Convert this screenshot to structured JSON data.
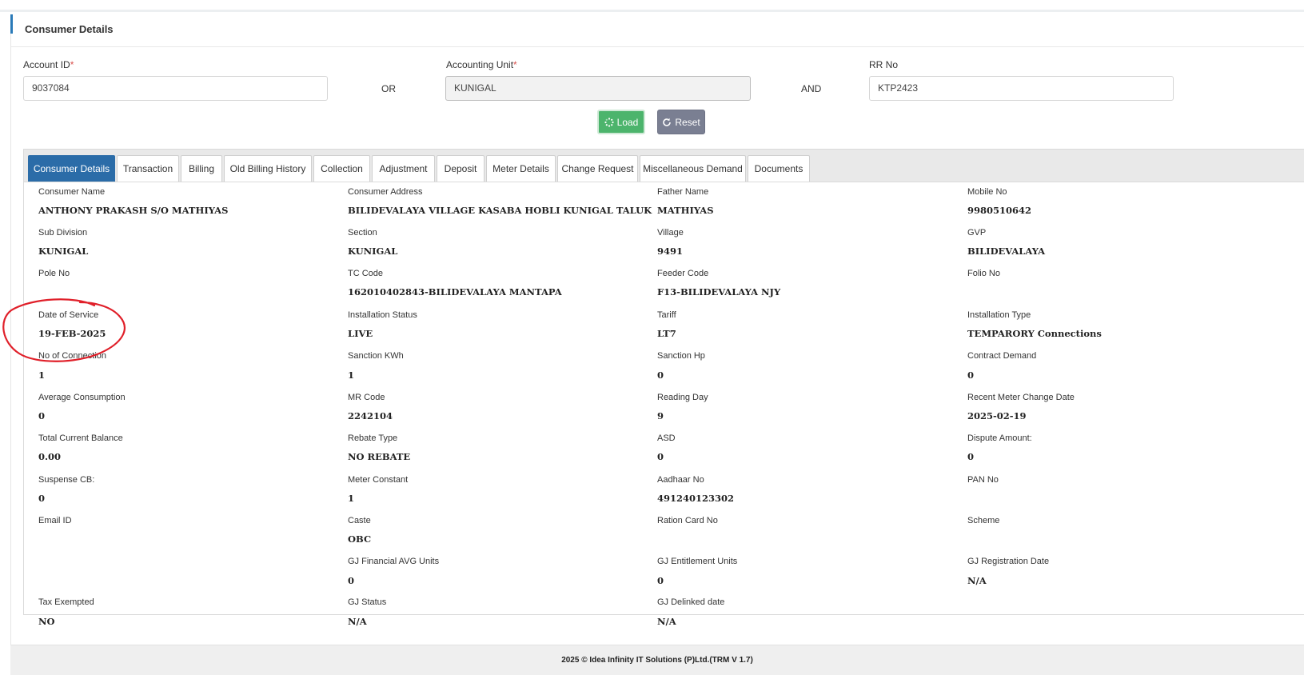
{
  "panel": {
    "title": "Consumer Details"
  },
  "search": {
    "account_id_label": "Account ID",
    "account_id_value": "9037084",
    "or_label": "OR",
    "accounting_unit_label": "Accounting Unit",
    "accounting_unit_value": "KUNIGAL",
    "and_label": "AND",
    "rr_no_label": "RR No",
    "rr_no_value": "KTP2423",
    "required_marker": "*",
    "load_label": "Load",
    "reset_label": "Reset",
    "load_color": "#4cb46c",
    "reset_color": "#7a7f92"
  },
  "tabs": [
    {
      "label": "Consumer Details",
      "active": true
    },
    {
      "label": "Transaction"
    },
    {
      "label": "Billing"
    },
    {
      "label": "Old Billing History"
    },
    {
      "label": "Collection"
    },
    {
      "label": "Adjustment"
    },
    {
      "label": "Deposit"
    },
    {
      "label": "Meter Details"
    },
    {
      "label": "Change Request"
    },
    {
      "label": "Miscellaneous Demand"
    },
    {
      "label": "Documents"
    }
  ],
  "details": {
    "consumer_name": {
      "label": "Consumer Name",
      "value": "ANTHONY PRAKASH S/O MATHIYAS"
    },
    "consumer_address": {
      "label": "Consumer Address",
      "value": "BILIDEVALAYA VILLAGE KASABA HOBLI KUNIGAL TALUK"
    },
    "father_name": {
      "label": "Father Name",
      "value": "MATHIYAS"
    },
    "mobile_no": {
      "label": "Mobile No",
      "value": "9980510642"
    },
    "sub_division": {
      "label": "Sub Division",
      "value": "KUNIGAL"
    },
    "section": {
      "label": "Section",
      "value": "KUNIGAL"
    },
    "village": {
      "label": "Village",
      "value": "9491"
    },
    "gvp": {
      "label": "GVP",
      "value": "BILIDEVALAYA"
    },
    "pole_no": {
      "label": "Pole No",
      "value": ""
    },
    "tc_code": {
      "label": "TC Code",
      "value": "162010402843-BILIDEVALAYA MANTAPA"
    },
    "feeder_code": {
      "label": "Feeder Code",
      "value": "F13-BILIDEVALAYA NJY"
    },
    "folio_no": {
      "label": "Folio No",
      "value": ""
    },
    "date_of_service": {
      "label": "Date of Service",
      "value": "19-FEB-2025"
    },
    "installation_status": {
      "label": "Installation Status",
      "value": "LIVE"
    },
    "tariff": {
      "label": "Tariff",
      "value": "LT7"
    },
    "installation_type": {
      "label": "Installation Type",
      "value": "TEMPARORY Connections"
    },
    "no_of_connection": {
      "label": "No of Connection",
      "value": "1"
    },
    "sanction_kwh": {
      "label": "Sanction KWh",
      "value": "1"
    },
    "sanction_hp": {
      "label": "Sanction Hp",
      "value": "0"
    },
    "contract_demand": {
      "label": "Contract Demand",
      "value": "0"
    },
    "average_consumption": {
      "label": "Average Consumption",
      "value": "0"
    },
    "mr_code": {
      "label": "MR Code",
      "value": "2242104"
    },
    "reading_day": {
      "label": "Reading Day",
      "value": "9"
    },
    "recent_meter_change_date": {
      "label": "Recent Meter Change Date",
      "value": "2025-02-19"
    },
    "total_current_balance": {
      "label": "Total Current Balance",
      "value": "0.00"
    },
    "rebate_type": {
      "label": "Rebate Type",
      "value": "NO REBATE"
    },
    "asd": {
      "label": "ASD",
      "value": "0"
    },
    "dispute_amount": {
      "label": "Dispute Amount:",
      "value": "0"
    },
    "suspense_cb": {
      "label": "Suspense CB:",
      "value": "0"
    },
    "meter_constant": {
      "label": "Meter Constant",
      "value": "1"
    },
    "aadhaar_no": {
      "label": "Aadhaar No",
      "value": "491240123302"
    },
    "pan_no": {
      "label": "PAN No",
      "value": ""
    },
    "email_id": {
      "label": "Email ID",
      "value": ""
    },
    "caste": {
      "label": "Caste",
      "value": "OBC"
    },
    "ration_card_no": {
      "label": "Ration Card No",
      "value": ""
    },
    "scheme": {
      "label": "Scheme",
      "value": ""
    },
    "gj_financial_avg_units": {
      "label": "GJ Financial AVG Units",
      "value": "0"
    },
    "gj_entitlement_units": {
      "label": "GJ Entitlement Units",
      "value": "0"
    },
    "gj_registration_date": {
      "label": "GJ Registration Date",
      "value": "N/A"
    },
    "tax_exempted": {
      "label": "Tax Exempted",
      "value": "NO"
    },
    "gj_status": {
      "label": "GJ Status",
      "value": "N/A"
    },
    "gj_delinked_date": {
      "label": "GJ Delinked date",
      "value": "N/A"
    }
  },
  "annotation_color": "#e0202a",
  "footer": {
    "text": "2025 © Idea Infinity IT Solutions (P)Ltd.(TRM V 1.7)"
  }
}
